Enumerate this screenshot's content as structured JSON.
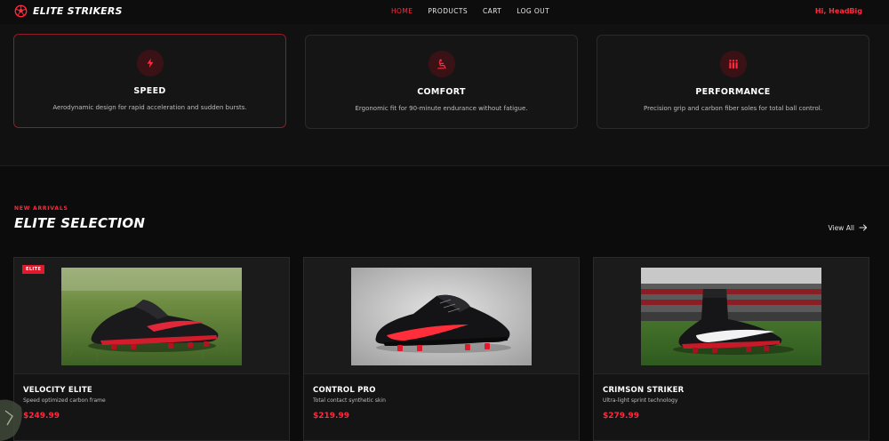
{
  "nav": {
    "brand": "ELITE STRIKERS",
    "links": [
      {
        "label": "HOME",
        "active": true
      },
      {
        "label": "PRODUCTS",
        "active": false
      },
      {
        "label": "CART",
        "active": false
      },
      {
        "label": "LOG OUT",
        "active": false
      }
    ],
    "greeting": "Hi, HeadBig"
  },
  "features": [
    {
      "icon": "lightning-icon",
      "title": "SPEED",
      "desc": "Aerodynamic design for rapid acceleration and sudden bursts."
    },
    {
      "icon": "seat-icon",
      "title": "COMFORT",
      "desc": "Ergonomic fit for 90-minute endurance without fatigue."
    },
    {
      "icon": "team-icon",
      "title": "PERFORMANCE",
      "desc": "Precision grip and carbon fiber soles for total ball control."
    }
  ],
  "selection": {
    "eyebrow": "NEW ARRIVALS",
    "title": "ELITE SELECTION",
    "view_all": "View All"
  },
  "products": [
    {
      "badge": "ELITE",
      "name": "VELOCITY ELITE",
      "desc": "Speed optimized carbon frame",
      "price": "$249.99"
    },
    {
      "badge": "",
      "name": "CONTROL PRO",
      "desc": "Total contact synthetic skin",
      "price": "$219.99"
    },
    {
      "badge": "",
      "name": "CRIMSON STRIKER",
      "desc": "Ultra-light sprint technology",
      "price": "$279.99"
    }
  ],
  "colors": {
    "accent": "#ff2a3d",
    "background": "#0c0c0c",
    "card": "#141414"
  }
}
